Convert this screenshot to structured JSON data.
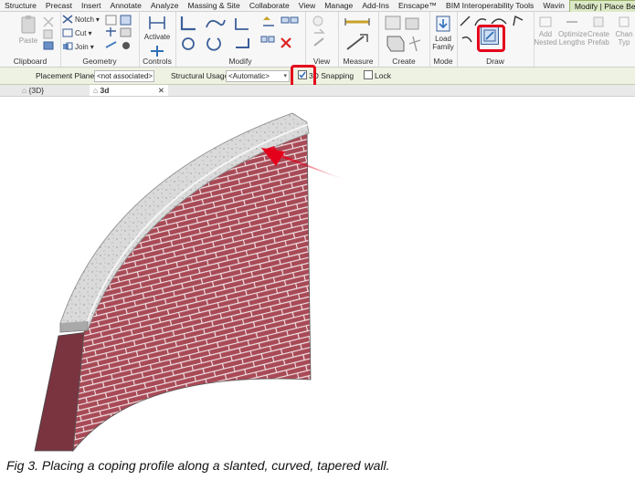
{
  "menu": {
    "tabs": [
      "Structure",
      "Precast",
      "Insert",
      "Annotate",
      "Analyze",
      "Massing & Site",
      "Collaborate",
      "View",
      "Manage",
      "Add-Ins",
      "Enscape™",
      "BIM Interoperability Tools",
      "Wavin",
      "Modify | Place Beam"
    ],
    "active_tab": "Modify | Place Beam"
  },
  "ribbon": {
    "panels": {
      "clipboard": "Clipboard",
      "geometry": "Geometry",
      "controls": "Controls",
      "modify": "Modify",
      "view": "View",
      "measure": "Measure",
      "create": "Create",
      "mode": "Mode",
      "draw": "Draw"
    },
    "paste_label": "Paste",
    "notch_label": "Notch",
    "cut_label": "Cut",
    "join_label": "Join",
    "activate_label": "Activate",
    "load_family_label": "Load Family",
    "add_nested_label": "Add Nested",
    "optimize_lengths_label": "Optimize Lengths",
    "create_prefab_label": "Create Prefab",
    "change_type_label": "Chan Typ"
  },
  "options_bar": {
    "placement_plane_label": "Placement Plane:",
    "placement_plane_value": "<not associated>",
    "structural_usage_label": "Structural Usage:",
    "structural_usage_value": "<Automatic>",
    "snapping_label": "3D Snapping",
    "snapping_checked": true,
    "lock_label": "Lock",
    "lock_checked": false
  },
  "view_tabs": [
    {
      "label": "{3D}",
      "active": false
    },
    {
      "label": "3d",
      "active": true
    }
  ],
  "caption": "Fig 3. Placing a coping profile along a slanted, curved, tapered wall.",
  "colors": {
    "highlight": "#e4001b",
    "brick": "#a84a56",
    "mortar": "#f1e3e6",
    "coping": "#d9d9d9",
    "active_tab": "#dce9c6"
  }
}
